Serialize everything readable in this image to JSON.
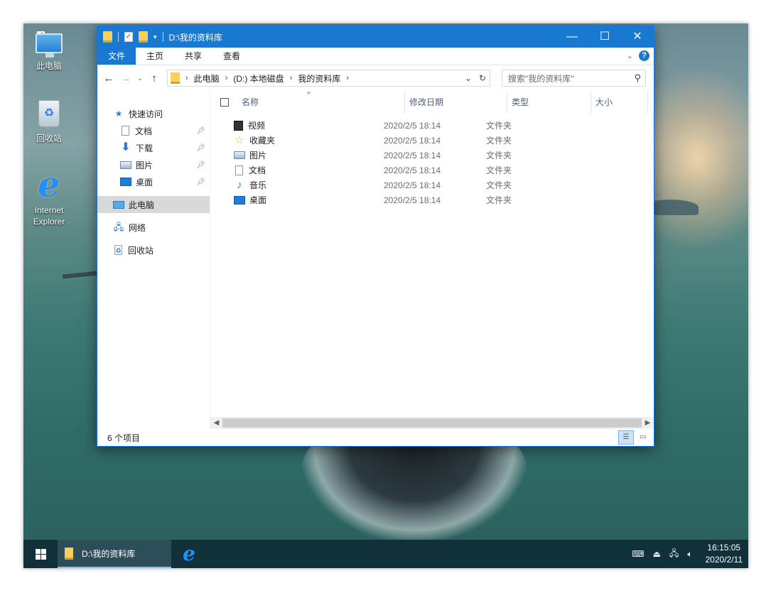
{
  "desktop": {
    "icons": [
      {
        "label": "此电脑",
        "icon": "computer-icon"
      },
      {
        "label": "回收站",
        "icon": "recycle-bin-icon"
      },
      {
        "label": "Internet Explorer",
        "icon": "internet-explorer-icon"
      }
    ]
  },
  "window": {
    "title": "D:\\我的资料库",
    "caption": {
      "minimize": "—",
      "maximize": "☐",
      "close": "✕"
    },
    "ribbon_tabs": [
      "文件",
      "主页",
      "共享",
      "查看"
    ],
    "address": {
      "breadcrumbs": [
        "此电脑",
        "(D:) 本地磁盘",
        "我的资料库"
      ]
    },
    "search": {
      "placeholder": "搜索\"我的资料库\""
    },
    "nav_pane": {
      "quick_access": "快速访问",
      "quick_items": [
        "文档",
        "下载",
        "图片",
        "桌面"
      ],
      "this_pc": "此电脑",
      "network": "网络",
      "recycle_bin": "回收站"
    },
    "columns": [
      "名称",
      "修改日期",
      "类型",
      "大小"
    ],
    "files": [
      {
        "name": "视频",
        "date": "2020/2/5 18:14",
        "type": "文件夹",
        "icon": "video-folder-icon"
      },
      {
        "name": "收藏夹",
        "date": "2020/2/5 18:14",
        "type": "文件夹",
        "icon": "favorites-folder-icon"
      },
      {
        "name": "图片",
        "date": "2020/2/5 18:14",
        "type": "文件夹",
        "icon": "pictures-folder-icon"
      },
      {
        "name": "文档",
        "date": "2020/2/5 18:14",
        "type": "文件夹",
        "icon": "documents-folder-icon"
      },
      {
        "name": "音乐",
        "date": "2020/2/5 18:14",
        "type": "文件夹",
        "icon": "music-folder-icon"
      },
      {
        "name": "桌面",
        "date": "2020/2/5 18:14",
        "type": "文件夹",
        "icon": "desktop-folder-icon"
      }
    ],
    "status": "6 个项目"
  },
  "taskbar": {
    "active_window": "D:\\我的资料库",
    "time": "16:15:05",
    "date": "2020/2/11"
  },
  "colors": {
    "titlebar": "#1979d0",
    "taskbar": "#10303a"
  }
}
